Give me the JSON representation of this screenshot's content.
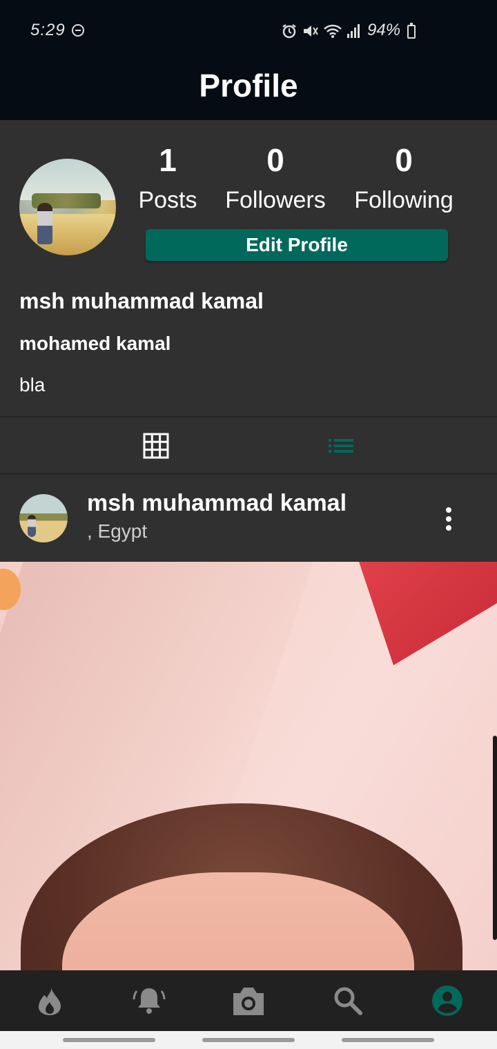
{
  "status_bar": {
    "time": "5:29",
    "battery": "94%"
  },
  "app_bar": {
    "title": "Profile"
  },
  "profile": {
    "stats": [
      {
        "value": "1",
        "label": "Posts"
      },
      {
        "value": "0",
        "label": "Followers"
      },
      {
        "value": "0",
        "label": "Following"
      }
    ],
    "edit_button_label": "Edit Profile",
    "display_name": "msh muhammad kamal",
    "username": "mohamed kamal",
    "bio": "bla"
  },
  "tabs": [
    {
      "icon": "grid-icon",
      "active": false
    },
    {
      "icon": "list-icon",
      "active": true
    }
  ],
  "post": {
    "author": "msh muhammad kamal",
    "location": ", Egypt"
  },
  "bottom_nav": [
    {
      "icon": "flame-icon",
      "active": false
    },
    {
      "icon": "bell-icon",
      "active": false
    },
    {
      "icon": "camera-icon",
      "active": false
    },
    {
      "icon": "search-icon",
      "active": false
    },
    {
      "icon": "account-circle-icon",
      "active": true
    }
  ],
  "colors": {
    "accent": "#00695c",
    "background": "#303030",
    "app_bar": "#050c14",
    "bottom_nav": "#212121",
    "inactive_icon": "#8a8a8a"
  }
}
